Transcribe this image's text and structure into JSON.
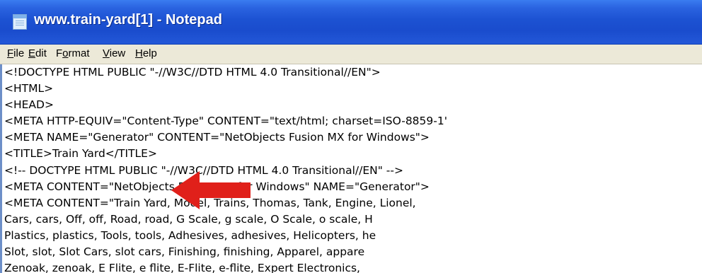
{
  "window": {
    "title": "www.train-yard[1] - Notepad",
    "icon": "notepad-icon"
  },
  "menu": {
    "items": [
      {
        "accel": "F",
        "rest": "ile"
      },
      {
        "accel": "E",
        "rest": "dit"
      },
      {
        "accel": "",
        "pre": "F",
        "accel2": "o",
        "rest": "rmat"
      },
      {
        "accel": "V",
        "rest": "iew"
      },
      {
        "accel": "H",
        "rest": "elp"
      }
    ]
  },
  "editor": {
    "lines": [
      "<!DOCTYPE HTML PUBLIC \"-//W3C//DTD HTML 4.0 Transitional//EN\">",
      "<HTML>",
      "<HEAD>",
      "<META HTTP-EQUIV=\"Content-Type\" CONTENT=\"text/html; charset=ISO-8859-1'",
      "<META NAME=\"Generator\" CONTENT=\"NetObjects Fusion MX for Windows\">",
      "<TITLE>Train Yard</TITLE>",
      "<!-- DOCTYPE HTML PUBLIC \"-//W3C//DTD HTML 4.0 Transitional//EN\" -->",
      "<META CONTENT=\"NetObjects Fusion MX for Windows\" NAME=\"Generator\">",
      "<META CONTENT=\"Train Yard, Model, Trains, Thomas, Tank, Engine, Lionel,",
      "Cars, cars, Off, off, Road, road, G Scale, g scale, O Scale, o scale, H",
      "Plastics, plastics, Tools, tools, Adhesives, adhesives, Helicopters, he",
      "Slot, slot, Slot Cars, slot cars, Finishing, finishing, Apparel, appare",
      "Zenoak, zenoak, E Flite, e flite, E-Flite, e-flite, Expert Electronics,"
    ]
  },
  "annotation": {
    "arrow_color": "#e0201a"
  }
}
